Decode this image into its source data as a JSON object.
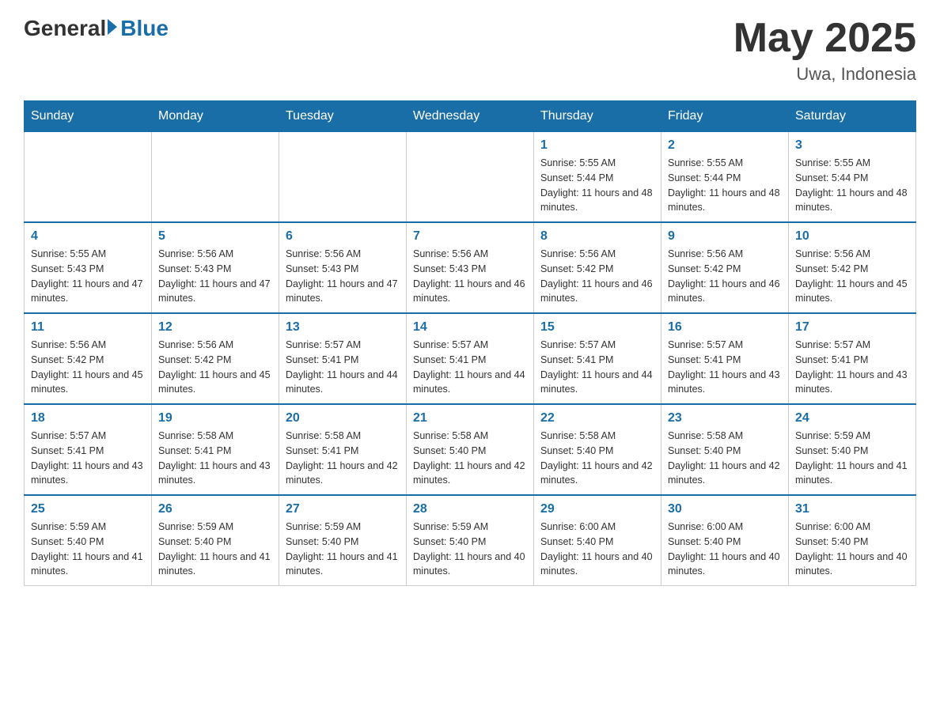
{
  "header": {
    "logo_general": "General",
    "logo_blue": "Blue",
    "month_year": "May 2025",
    "location": "Uwa, Indonesia"
  },
  "days_of_week": [
    "Sunday",
    "Monday",
    "Tuesday",
    "Wednesday",
    "Thursday",
    "Friday",
    "Saturday"
  ],
  "weeks": [
    {
      "days": [
        {
          "num": "",
          "info": ""
        },
        {
          "num": "",
          "info": ""
        },
        {
          "num": "",
          "info": ""
        },
        {
          "num": "",
          "info": ""
        },
        {
          "num": "1",
          "info": "Sunrise: 5:55 AM\nSunset: 5:44 PM\nDaylight: 11 hours and 48 minutes."
        },
        {
          "num": "2",
          "info": "Sunrise: 5:55 AM\nSunset: 5:44 PM\nDaylight: 11 hours and 48 minutes."
        },
        {
          "num": "3",
          "info": "Sunrise: 5:55 AM\nSunset: 5:44 PM\nDaylight: 11 hours and 48 minutes."
        }
      ]
    },
    {
      "days": [
        {
          "num": "4",
          "info": "Sunrise: 5:55 AM\nSunset: 5:43 PM\nDaylight: 11 hours and 47 minutes."
        },
        {
          "num": "5",
          "info": "Sunrise: 5:56 AM\nSunset: 5:43 PM\nDaylight: 11 hours and 47 minutes."
        },
        {
          "num": "6",
          "info": "Sunrise: 5:56 AM\nSunset: 5:43 PM\nDaylight: 11 hours and 47 minutes."
        },
        {
          "num": "7",
          "info": "Sunrise: 5:56 AM\nSunset: 5:43 PM\nDaylight: 11 hours and 46 minutes."
        },
        {
          "num": "8",
          "info": "Sunrise: 5:56 AM\nSunset: 5:42 PM\nDaylight: 11 hours and 46 minutes."
        },
        {
          "num": "9",
          "info": "Sunrise: 5:56 AM\nSunset: 5:42 PM\nDaylight: 11 hours and 46 minutes."
        },
        {
          "num": "10",
          "info": "Sunrise: 5:56 AM\nSunset: 5:42 PM\nDaylight: 11 hours and 45 minutes."
        }
      ]
    },
    {
      "days": [
        {
          "num": "11",
          "info": "Sunrise: 5:56 AM\nSunset: 5:42 PM\nDaylight: 11 hours and 45 minutes."
        },
        {
          "num": "12",
          "info": "Sunrise: 5:56 AM\nSunset: 5:42 PM\nDaylight: 11 hours and 45 minutes."
        },
        {
          "num": "13",
          "info": "Sunrise: 5:57 AM\nSunset: 5:41 PM\nDaylight: 11 hours and 44 minutes."
        },
        {
          "num": "14",
          "info": "Sunrise: 5:57 AM\nSunset: 5:41 PM\nDaylight: 11 hours and 44 minutes."
        },
        {
          "num": "15",
          "info": "Sunrise: 5:57 AM\nSunset: 5:41 PM\nDaylight: 11 hours and 44 minutes."
        },
        {
          "num": "16",
          "info": "Sunrise: 5:57 AM\nSunset: 5:41 PM\nDaylight: 11 hours and 43 minutes."
        },
        {
          "num": "17",
          "info": "Sunrise: 5:57 AM\nSunset: 5:41 PM\nDaylight: 11 hours and 43 minutes."
        }
      ]
    },
    {
      "days": [
        {
          "num": "18",
          "info": "Sunrise: 5:57 AM\nSunset: 5:41 PM\nDaylight: 11 hours and 43 minutes."
        },
        {
          "num": "19",
          "info": "Sunrise: 5:58 AM\nSunset: 5:41 PM\nDaylight: 11 hours and 43 minutes."
        },
        {
          "num": "20",
          "info": "Sunrise: 5:58 AM\nSunset: 5:41 PM\nDaylight: 11 hours and 42 minutes."
        },
        {
          "num": "21",
          "info": "Sunrise: 5:58 AM\nSunset: 5:40 PM\nDaylight: 11 hours and 42 minutes."
        },
        {
          "num": "22",
          "info": "Sunrise: 5:58 AM\nSunset: 5:40 PM\nDaylight: 11 hours and 42 minutes."
        },
        {
          "num": "23",
          "info": "Sunrise: 5:58 AM\nSunset: 5:40 PM\nDaylight: 11 hours and 42 minutes."
        },
        {
          "num": "24",
          "info": "Sunrise: 5:59 AM\nSunset: 5:40 PM\nDaylight: 11 hours and 41 minutes."
        }
      ]
    },
    {
      "days": [
        {
          "num": "25",
          "info": "Sunrise: 5:59 AM\nSunset: 5:40 PM\nDaylight: 11 hours and 41 minutes."
        },
        {
          "num": "26",
          "info": "Sunrise: 5:59 AM\nSunset: 5:40 PM\nDaylight: 11 hours and 41 minutes."
        },
        {
          "num": "27",
          "info": "Sunrise: 5:59 AM\nSunset: 5:40 PM\nDaylight: 11 hours and 41 minutes."
        },
        {
          "num": "28",
          "info": "Sunrise: 5:59 AM\nSunset: 5:40 PM\nDaylight: 11 hours and 40 minutes."
        },
        {
          "num": "29",
          "info": "Sunrise: 6:00 AM\nSunset: 5:40 PM\nDaylight: 11 hours and 40 minutes."
        },
        {
          "num": "30",
          "info": "Sunrise: 6:00 AM\nSunset: 5:40 PM\nDaylight: 11 hours and 40 minutes."
        },
        {
          "num": "31",
          "info": "Sunrise: 6:00 AM\nSunset: 5:40 PM\nDaylight: 11 hours and 40 minutes."
        }
      ]
    }
  ]
}
